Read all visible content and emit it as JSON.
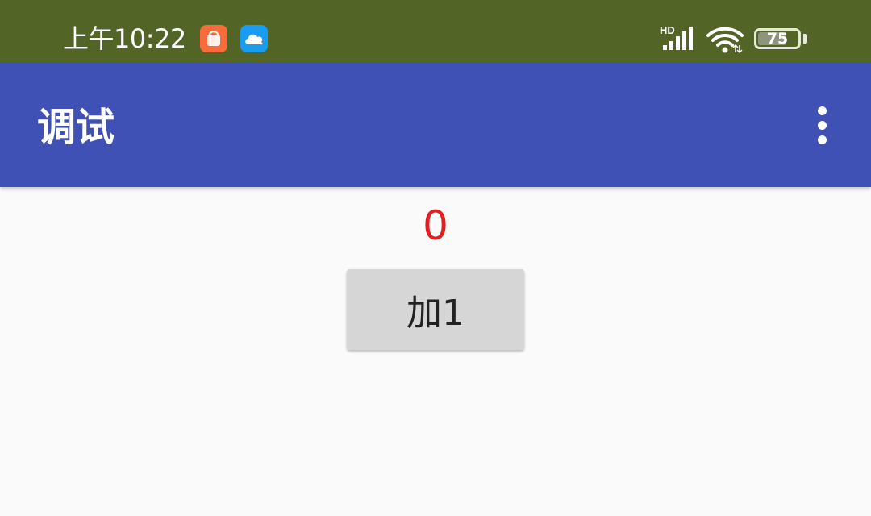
{
  "status_bar": {
    "time": "上午10:22",
    "notification_icons": [
      "store-icon",
      "cloud-icon"
    ],
    "signal_label": "HD",
    "battery_level": "75",
    "battery_percent": 75,
    "background_color": "#536526"
  },
  "app_bar": {
    "title": "调试",
    "menu_icon": "more-vert-icon",
    "background_color": "#3f51b5"
  },
  "main": {
    "counter_value": "0",
    "counter_color": "#e02020",
    "add_button_label": "加1"
  }
}
